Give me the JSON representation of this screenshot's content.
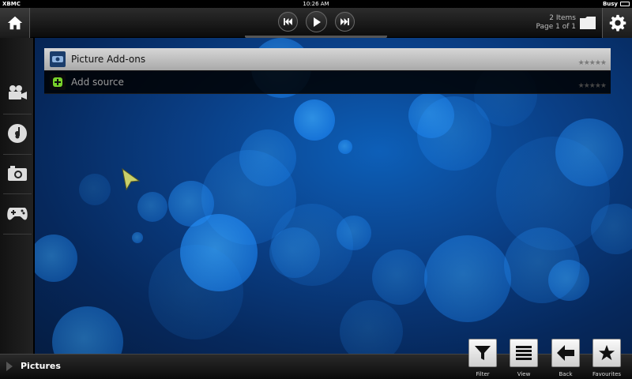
{
  "status_bar": {
    "app_name": "XBMC",
    "time": "10:26 AM",
    "status": "Busy"
  },
  "top_bar": {
    "item_count": "2 Items",
    "page_info": "Page 1 of 1",
    "icons": [
      "home-icon",
      "previous-track-icon",
      "play-icon",
      "next-track-icon",
      "folder-icon",
      "gear-icon"
    ]
  },
  "side_nav": {
    "items": [
      {
        "name": "movies",
        "icon": "video-camera-icon"
      },
      {
        "name": "music",
        "icon": "music-disc-icon"
      },
      {
        "name": "pictures",
        "icon": "camera-icon"
      },
      {
        "name": "games",
        "icon": "gamepad-icon"
      }
    ]
  },
  "list": {
    "items": [
      {
        "label": "Picture Add-ons",
        "selected": true,
        "icon": "addon-package-icon",
        "rating": "★★★★★"
      },
      {
        "label": "Add source",
        "selected": false,
        "icon": "add-source-icon",
        "rating": "★★★★★"
      }
    ]
  },
  "bottom_bar": {
    "breadcrumb": "Pictures"
  },
  "actions": [
    {
      "label": "Filter",
      "icon": "filter-icon"
    },
    {
      "label": "View",
      "icon": "list-view-icon"
    },
    {
      "label": "Back",
      "icon": "back-arrow-icon"
    },
    {
      "label": "Favourites",
      "icon": "star-icon"
    }
  ],
  "colors": {
    "background_deep": "#041838",
    "background_bright": "#0d5fb8",
    "bokeh": "#1e90ff",
    "bar": "#111111",
    "selected_row": "#c8c8c8"
  }
}
